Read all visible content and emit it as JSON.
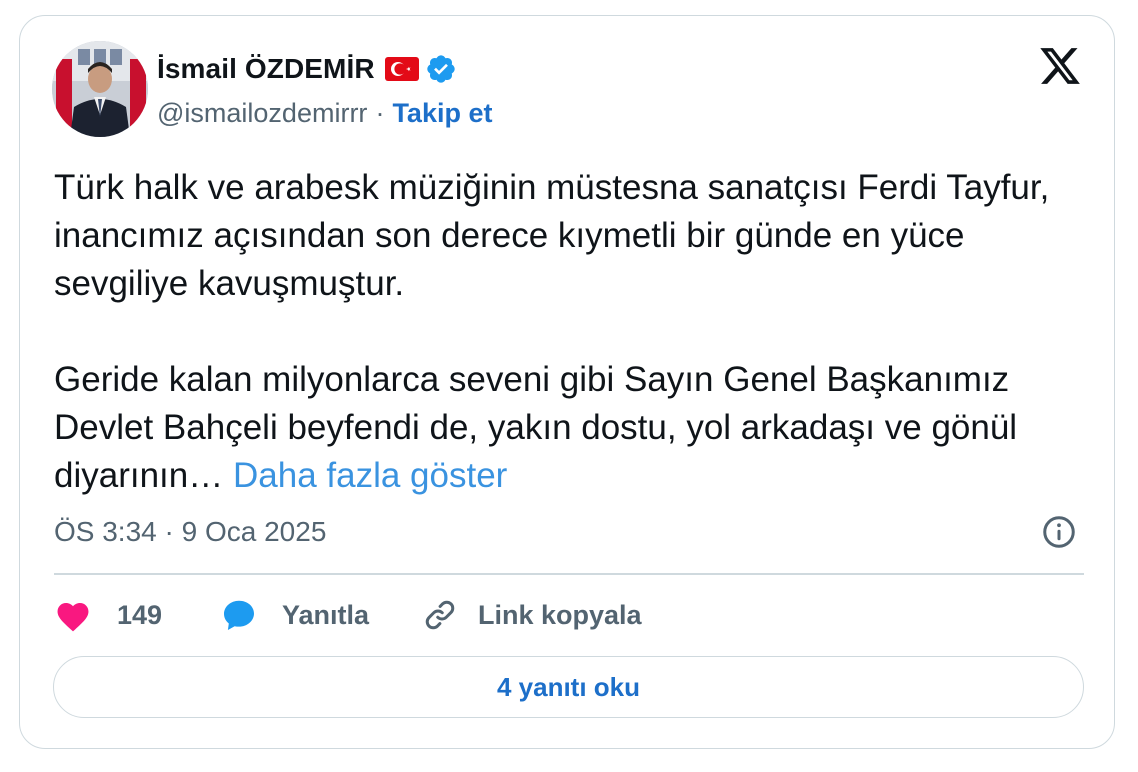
{
  "author": {
    "name": "İsmail ÖZDEMİR",
    "handle": "@ismailozdemirrr",
    "separator": "·",
    "follow_label": "Takip et"
  },
  "tweet": {
    "paragraph_1": "Türk halk ve arabesk müziğinin müstesna sanatçısı Ferdi Tayfur, inancımız açısından son derece kıymetli bir günde en yüce sevgiliye kavuşmuştur.",
    "paragraph_2": "Geride kalan milyonlarca seveni gibi Sayın Genel Başkanımız Devlet Bahçeli beyfendi de, yakın dostu, yol arkadaşı ve gönül diyarının…",
    "show_more_label": "Daha fazla göster",
    "timestamp": "ÖS 3:34 · 9 Oca 2025"
  },
  "actions": {
    "like_count": "149",
    "reply_label": "Yanıtla",
    "copy_link_label": "Link kopyala"
  },
  "read_replies_label": "4 yanıtı oku",
  "icons": {
    "brand": "x-logo-icon",
    "verified": "verified-badge-icon",
    "flag": "turkey-flag-icon",
    "info": "info-icon",
    "like": "heart-icon",
    "reply": "speech-bubble-icon",
    "link": "link-icon"
  },
  "colors": {
    "link_blue": "#1d6fc9",
    "show_more_blue": "#3a93e0",
    "heart_pink": "#f91880",
    "reply_blue": "#1d9bf0",
    "verified_blue": "#1d9bf0",
    "muted_text": "#536471",
    "border": "#cfd9de"
  }
}
